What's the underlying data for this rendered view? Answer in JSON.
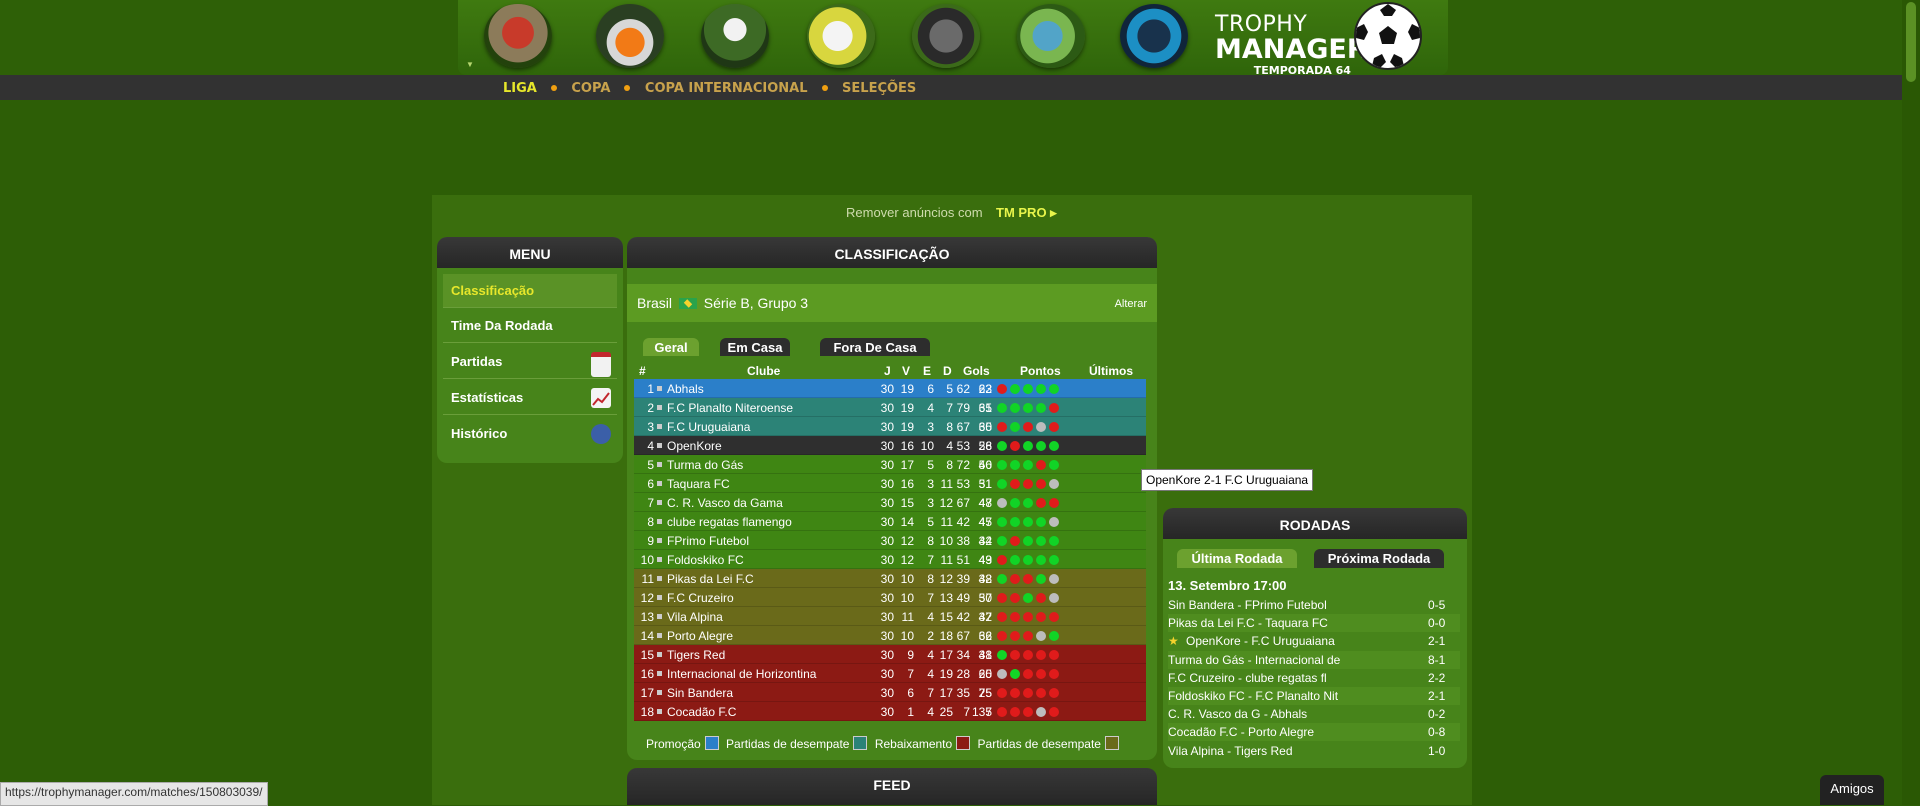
{
  "logo": {
    "line1": "TROPHY",
    "line2": "MANAGER",
    "season": "TEMPORADA 64"
  },
  "top_icons": [
    "home-icon",
    "whistle-cones-icon",
    "player-icon",
    "contract-trophy-icon",
    "binoculars-icon",
    "globe-chat-icon",
    "tmpro-badge-icon"
  ],
  "nav": {
    "items": [
      "LIGA",
      "COPA",
      "COPA INTERNACIONAL",
      "SELEÇÕES"
    ],
    "active": "LIGA"
  },
  "ad": {
    "text": "Remover anúncios com",
    "pro": "TM PRO ▸"
  },
  "menu": {
    "title": "MENU",
    "items": [
      {
        "label": "Classificação",
        "active": true,
        "icon": ""
      },
      {
        "label": "Time Da Rodada",
        "active": false,
        "icon": ""
      },
      {
        "label": "Partidas",
        "active": false,
        "icon": "calendar-icon"
      },
      {
        "label": "Estatísticas",
        "active": false,
        "icon": "stats-chart-icon"
      },
      {
        "label": "Histórico",
        "active": false,
        "icon": "history-clock-icon"
      }
    ]
  },
  "standings": {
    "title": "CLASSIFICAÇÃO",
    "country": "Brasil",
    "league": "Série B, Grupo 3",
    "change": "Alterar",
    "tabs": [
      "Geral",
      "Em Casa",
      "Fora De Casa"
    ],
    "headers": {
      "pos": "#",
      "club": "Clube",
      "j": "J",
      "v": "V",
      "e": "E",
      "d": "D",
      "gols": "Gols",
      "pts": "Pontos",
      "last": "Últimos"
    },
    "rows": [
      {
        "pos": "1",
        "club": "Abhals",
        "j": "30",
        "v": "19",
        "e": "6",
        "d": "5",
        "gf": "62",
        "ga": "22",
        "pts": "63",
        "zone": "promo",
        "last": [
          "r",
          "g",
          "g",
          "g",
          "g"
        ]
      },
      {
        "pos": "2",
        "club": "F.C Planalto Niteroense",
        "j": "30",
        "v": "19",
        "e": "4",
        "d": "7",
        "gf": "79",
        "ga": "35",
        "pts": "61",
        "zone": "playoff_up",
        "last": [
          "g",
          "g",
          "g",
          "g",
          "r"
        ]
      },
      {
        "pos": "3",
        "club": "F.C Uruguaiana",
        "j": "30",
        "v": "19",
        "e": "3",
        "d": "8",
        "gf": "67",
        "ga": "35",
        "pts": "60",
        "zone": "playoff_up",
        "last": [
          "r",
          "g",
          "r",
          "y",
          "r"
        ]
      },
      {
        "pos": "4",
        "club": "OpenKore",
        "j": "30",
        "v": "16",
        "e": "10",
        "d": "4",
        "gf": "53",
        "ga": "26",
        "pts": "58",
        "zone": "selected",
        "last": [
          "g",
          "r",
          "g",
          "g",
          "g"
        ]
      },
      {
        "pos": "5",
        "club": "Turma do Gás",
        "j": "30",
        "v": "17",
        "e": "5",
        "d": "8",
        "gf": "72",
        "ga": "40",
        "pts": "56",
        "zone": "mid",
        "last": [
          "g",
          "g",
          "g",
          "r",
          "g"
        ]
      },
      {
        "pos": "6",
        "club": "Taquara FC",
        "j": "30",
        "v": "16",
        "e": "3",
        "d": "11",
        "gf": "53",
        "ga": "31",
        "pts": "51",
        "zone": "mid",
        "last": [
          "g",
          "r",
          "r",
          "r",
          "y"
        ]
      },
      {
        "pos": "7",
        "club": "C. R. Vasco da Gama",
        "j": "30",
        "v": "15",
        "e": "3",
        "d": "12",
        "gf": "67",
        "ga": "47",
        "pts": "48",
        "zone": "mid",
        "last": [
          "y",
          "g",
          "g",
          "r",
          "r"
        ]
      },
      {
        "pos": "8",
        "club": "clube regatas flamengo",
        "j": "30",
        "v": "14",
        "e": "5",
        "d": "11",
        "gf": "42",
        "ga": "45",
        "pts": "47",
        "zone": "mid",
        "last": [
          "g",
          "g",
          "g",
          "g",
          "y"
        ]
      },
      {
        "pos": "9",
        "club": "FPrimo Futebol",
        "j": "30",
        "v": "12",
        "e": "8",
        "d": "10",
        "gf": "38",
        "ga": "32",
        "pts": "44",
        "zone": "mid",
        "last": [
          "g",
          "r",
          "g",
          "g",
          "g"
        ]
      },
      {
        "pos": "10",
        "club": "Foldoskiko FC",
        "j": "30",
        "v": "12",
        "e": "7",
        "d": "11",
        "gf": "51",
        "ga": "49",
        "pts": "43",
        "zone": "mid",
        "last": [
          "r",
          "g",
          "g",
          "g",
          "g"
        ]
      },
      {
        "pos": "11",
        "club": "Pikas da Lei F.C",
        "j": "30",
        "v": "10",
        "e": "8",
        "d": "12",
        "gf": "39",
        "ga": "42",
        "pts": "38",
        "zone": "lowmid",
        "last": [
          "g",
          "r",
          "r",
          "g",
          "y"
        ]
      },
      {
        "pos": "12",
        "club": "F.C Cruzeiro",
        "j": "30",
        "v": "10",
        "e": "7",
        "d": "13",
        "gf": "49",
        "ga": "50",
        "pts": "37",
        "zone": "lowmid",
        "last": [
          "r",
          "r",
          "g",
          "r",
          "y"
        ]
      },
      {
        "pos": "13",
        "club": "Vila Alpina",
        "j": "30",
        "v": "11",
        "e": "4",
        "d": "15",
        "gf": "42",
        "ga": "42",
        "pts": "37",
        "zone": "lowmid",
        "last": [
          "r",
          "r",
          "r",
          "r",
          "r"
        ]
      },
      {
        "pos": "14",
        "club": "Porto Alegre",
        "j": "30",
        "v": "10",
        "e": "2",
        "d": "18",
        "gf": "67",
        "ga": "66",
        "pts": "32",
        "zone": "lowmid",
        "last": [
          "r",
          "r",
          "r",
          "y",
          "g"
        ]
      },
      {
        "pos": "15",
        "club": "Tigers Red",
        "j": "30",
        "v": "9",
        "e": "4",
        "d": "17",
        "gf": "34",
        "ga": "48",
        "pts": "31",
        "zone": "releg",
        "last": [
          "g",
          "r",
          "r",
          "r",
          "r"
        ]
      },
      {
        "pos": "16",
        "club": "Internacional de Horizontina",
        "j": "30",
        "v": "7",
        "e": "4",
        "d": "19",
        "gf": "28",
        "ga": "60",
        "pts": "25",
        "zone": "releg",
        "last": [
          "y",
          "g",
          "r",
          "r",
          "r"
        ]
      },
      {
        "pos": "17",
        "club": "Sin Bandera",
        "j": "30",
        "v": "6",
        "e": "7",
        "d": "17",
        "gf": "35",
        "ga": "75",
        "pts": "25",
        "zone": "releg",
        "last": [
          "r",
          "r",
          "r",
          "r",
          "r"
        ]
      },
      {
        "pos": "18",
        "club": "Cocadão F.C",
        "j": "30",
        "v": "1",
        "e": "4",
        "d": "25",
        "gf": "7",
        "ga": "135",
        "pts": "7",
        "zone": "releg",
        "last": [
          "r",
          "r",
          "r",
          "y",
          "r"
        ]
      }
    ],
    "legend": [
      "Promoção",
      "Partidas de desempate",
      "Rebaixamento",
      "Partidas de desempate"
    ]
  },
  "tooltip": "OpenKore 2-1 F.C Uruguaiana",
  "rodadas": {
    "title": "RODADAS",
    "tabs": [
      "Última Rodada",
      "Próxima Rodada"
    ],
    "date": "13. Setembro 17:00",
    "matches": [
      {
        "teams": "Sin Bandera - FPrimo Futebol",
        "score": "0-5"
      },
      {
        "teams": "Pikas da Lei F.C - Taquara FC",
        "score": "0-0"
      },
      {
        "teams": "OpenKore - F.C Uruguaiana",
        "score": "2-1",
        "star": true
      },
      {
        "teams": "Turma do Gás - Internacional de",
        "score": "8-1"
      },
      {
        "teams": "F.C Cruzeiro - clube regatas fl",
        "score": "2-2"
      },
      {
        "teams": "Foldoskiko FC - F.C Planalto Nit",
        "score": "2-1"
      },
      {
        "teams": "C. R. Vasco da G - Abhals",
        "score": "0-2"
      },
      {
        "teams": "Cocadão F.C - Porto Alegre",
        "score": "0-8"
      },
      {
        "teams": "Vila Alpina - Tigers Red",
        "score": "1-0"
      }
    ]
  },
  "feed_title": "FEED",
  "status_url": "https://trophymanager.com/matches/150803039/",
  "friends": "Amigos",
  "colors": {
    "promo": "#2b7fc9",
    "playoff_up": "#2c8377",
    "selected": "#2f2f2f",
    "mid": "#3f8613",
    "lowmid": "#6a6a1a",
    "releg": "#8c1a14",
    "win": "#11d426",
    "loss": "#e01b1b",
    "draw": "#bdbdbd"
  }
}
